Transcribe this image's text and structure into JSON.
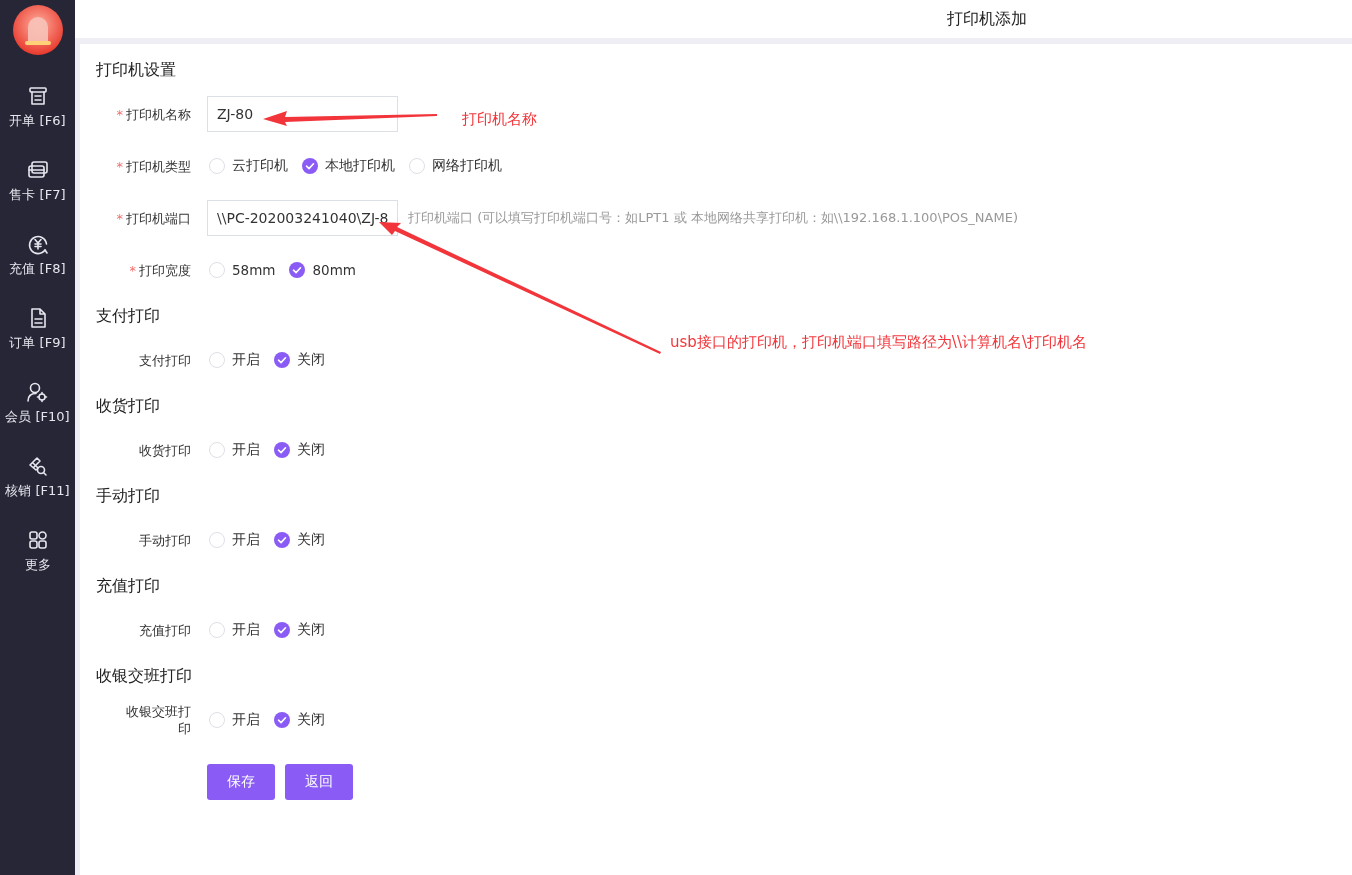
{
  "header": {
    "title": "打印机添加"
  },
  "sidebar": {
    "items": [
      {
        "label": "开单 [F6]"
      },
      {
        "label": "售卡 [F7]"
      },
      {
        "label": "充值 [F8]"
      },
      {
        "label": "订单 [F9]"
      },
      {
        "label": "会员 [F10]"
      },
      {
        "label": "核销 [F11]"
      },
      {
        "label": "更多"
      }
    ]
  },
  "sections": [
    {
      "title": "打印机设置",
      "fields": [
        {
          "kind": "text",
          "label": "打印机名称",
          "required_mark": "*",
          "value": "ZJ-80"
        },
        {
          "kind": "radio",
          "label": "打印机类型",
          "required_mark": "*",
          "options": [
            {
              "label": "云打印机",
              "selected": false
            },
            {
              "label": "本地打印机",
              "selected": true
            },
            {
              "label": "网络打印机",
              "selected": false
            }
          ]
        },
        {
          "kind": "text",
          "label": "打印机端口",
          "required_mark": "*",
          "value": "\\\\PC-202003241040\\ZJ-8",
          "hint": "打印机端口 (可以填写打印机端口号：如LPT1 或 本地网络共享打印机：如\\\\192.168.1.100\\POS_NAME)"
        },
        {
          "kind": "radio",
          "label": "打印宽度",
          "required_mark": "*",
          "options": [
            {
              "label": "58mm",
              "selected": false
            },
            {
              "label": "80mm",
              "selected": true
            }
          ]
        }
      ]
    },
    {
      "title": "支付打印",
      "fields": [
        {
          "kind": "radio",
          "label": "支付打印",
          "options": [
            {
              "label": "开启",
              "selected": false
            },
            {
              "label": "关闭",
              "selected": true
            }
          ]
        }
      ]
    },
    {
      "title": "收货打印",
      "fields": [
        {
          "kind": "radio",
          "label": "收货打印",
          "options": [
            {
              "label": "开启",
              "selected": false
            },
            {
              "label": "关闭",
              "selected": true
            }
          ]
        }
      ]
    },
    {
      "title": "手动打印",
      "fields": [
        {
          "kind": "radio",
          "label": "手动打印",
          "options": [
            {
              "label": "开启",
              "selected": false
            },
            {
              "label": "关闭",
              "selected": true
            }
          ]
        }
      ]
    },
    {
      "title": "充值打印",
      "fields": [
        {
          "kind": "radio",
          "label": "充值打印",
          "options": [
            {
              "label": "开启",
              "selected": false
            },
            {
              "label": "关闭",
              "selected": true
            }
          ]
        }
      ]
    },
    {
      "title": "收银交班打印",
      "fields": [
        {
          "kind": "radio",
          "label": "收银交班打印",
          "options": [
            {
              "label": "开启",
              "selected": false
            },
            {
              "label": "关闭",
              "selected": true
            }
          ]
        }
      ]
    }
  ],
  "buttons": [
    "保存",
    "返回"
  ],
  "annotations": [
    {
      "text": "打印机名称"
    },
    {
      "text": "usb接口的打印机，打印机端口填写路径为\\\\计算机名\\打印机名"
    }
  ]
}
